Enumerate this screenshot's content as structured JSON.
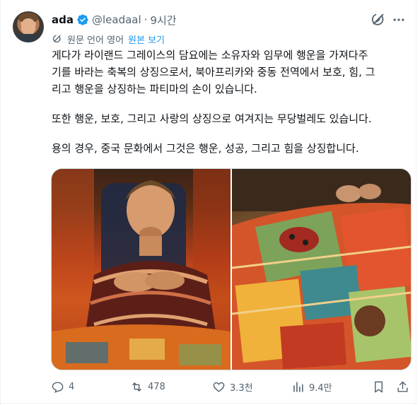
{
  "author": {
    "name": "ada",
    "handle": "@leadaal",
    "separator": "·",
    "time": "9시간"
  },
  "translation": {
    "label": "원문 언어 영어",
    "view_original": "원본 보기"
  },
  "body": {
    "paragraph1_line1": "게다가 라이랜드 그레이스의 담요에는 소유자와 임무에 행운을 가져다주",
    "paragraph1_line2": "기를 바라는 축복의 상징으로서, 북아프리카와 중동 전역에서 보호, 힘, 그",
    "paragraph1_line3": "리고 행운을 상징하는 파티마의 손이 있습니다.",
    "paragraph2": "또한 행운, 보호, 그리고 사랑의 상징으로 여겨지는 무당벌레도 있습니다.",
    "paragraph3": "용의 경우, 중국 문화에서 그것은 행운, 성공, 그리고 힘을 상징합니다."
  },
  "actions": {
    "replies": "4",
    "reposts": "478",
    "likes": "3.3천",
    "views": "9.4만"
  },
  "colors": {
    "accent": "#1d9bf0",
    "secondary_text": "#536471",
    "primary_text": "#0f1419",
    "border": "#cfd9de"
  },
  "icons": {
    "verified": "verified-badge-icon",
    "grok": "grok-icon",
    "more": "more-icon",
    "translate": "translate-icon",
    "reply": "reply-icon",
    "repost": "repost-icon",
    "like": "heart-icon",
    "views": "views-icon",
    "bookmark": "bookmark-icon",
    "share": "share-icon"
  }
}
